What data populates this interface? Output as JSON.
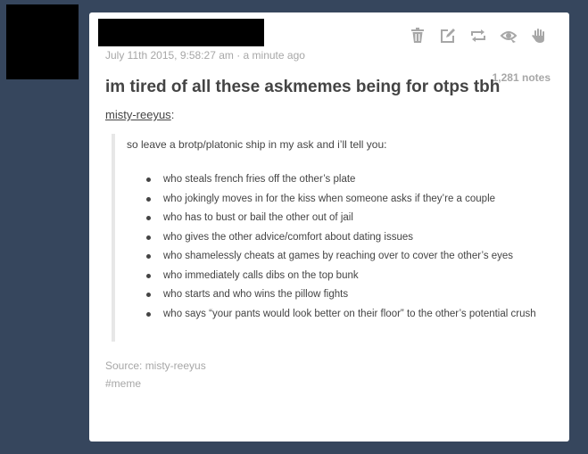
{
  "post": {
    "timestamp": "July 11th 2015, 9:58:27 am · a minute ago",
    "notes": "1,281 notes",
    "title": "im tired of all these askmemes being for otps tbh",
    "reblog_from": "misty-reeyus",
    "reblog_colon": ":",
    "quote_intro": "so leave a brotp/platonic ship in my ask and i’ll tell you:",
    "items": [
      "who steals french fries off the other’s plate",
      "who jokingly moves in for the kiss when someone asks if they’re a couple",
      "who has to bust or bail the other out of jail",
      "who gives the other advice/comfort about dating issues",
      "who shamelessly cheats at games by reaching over to cover the other’s eyes",
      "who immediately calls dibs on the top bunk",
      "who starts and who wins the pillow fights",
      "who says “your pants would look better on their floor” to the other’s potential crush"
    ],
    "source": "Source: misty-reeyus",
    "tag": "#meme"
  },
  "controls": {
    "icons": [
      "trash-icon",
      "edit-icon",
      "reblog-icon",
      "queue-icon",
      "hand-icon"
    ]
  },
  "colors": {
    "background": "#36465d",
    "card": "#ffffff",
    "text": "#444444",
    "muted": "#a7a7a7",
    "icon": "#a7a7a7"
  }
}
